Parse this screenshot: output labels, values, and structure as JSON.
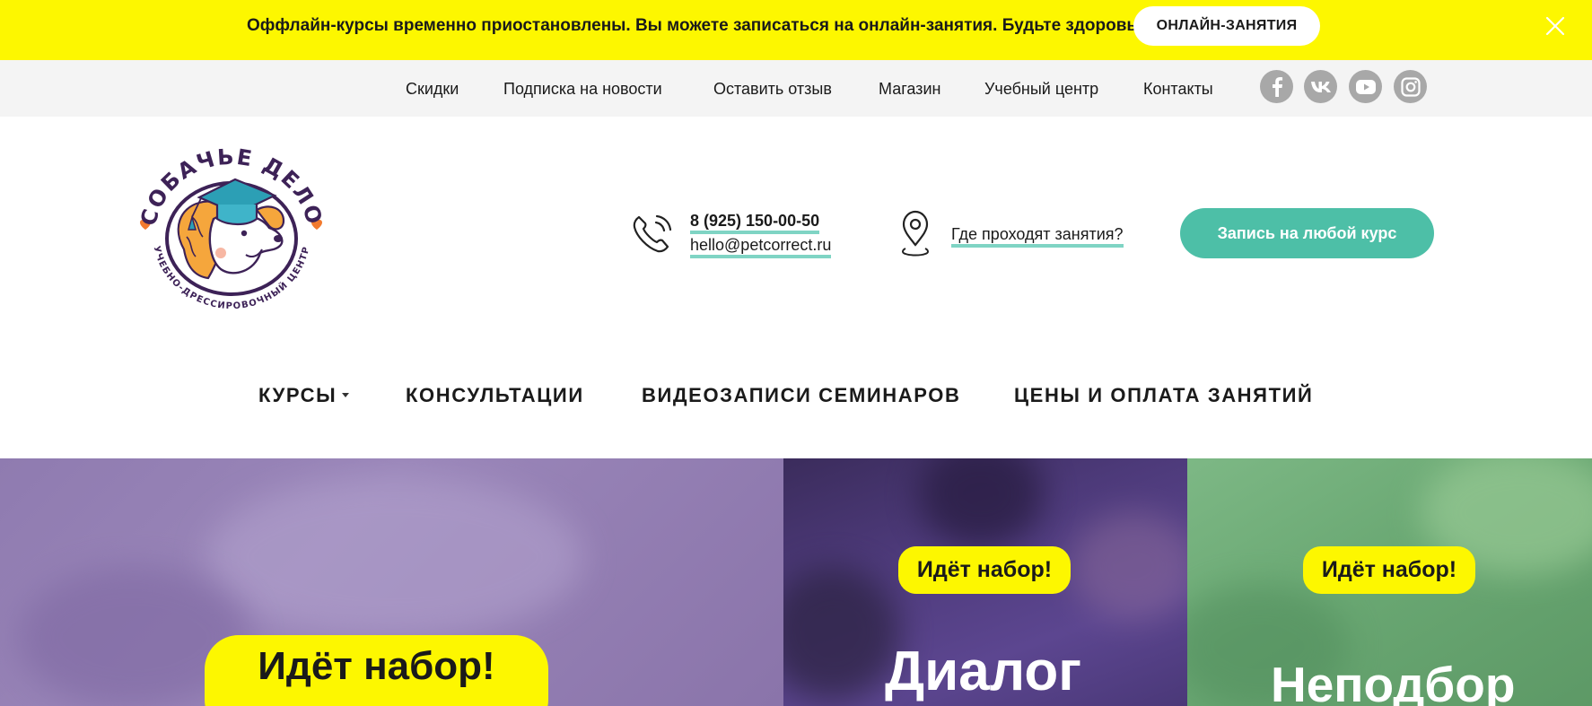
{
  "banner": {
    "text": "Оффлайн-курсы временно приостановлены. Вы можете записаться на онлайн-занятия. Будьте здоровы!",
    "button_label": "ОНЛАЙН-ЗАНЯТИЯ",
    "close_icon": "close-icon"
  },
  "subnav": {
    "items": [
      {
        "label": "Скидки"
      },
      {
        "label": "Подписка на новости"
      },
      {
        "label": "Оставить отзыв"
      },
      {
        "label": "Магазин"
      },
      {
        "label": "Учебный центр"
      },
      {
        "label": "Контакты"
      }
    ],
    "social": [
      "facebook-icon",
      "vk-icon",
      "youtube-icon",
      "instagram-icon"
    ]
  },
  "header": {
    "logo": {
      "title": "СОБАЧЬЕ ДЕЛО",
      "subtitle": "УЧЕБНО-ДРЕССИРОВОЧНЫЙ ЦЕНТР"
    },
    "phone": "8 (925) 150-00-50",
    "email": "hello@petcorrect.ru",
    "where_label": "Где проходят занятия?",
    "cta_label": "Запись на любой курс"
  },
  "mainnav": {
    "items": [
      {
        "label": "КУРСЫ"
      },
      {
        "label": "КОНСУЛЬТАЦИИ"
      },
      {
        "label": "ВИДЕОЗАПИСИ СЕМИНАРОВ"
      },
      {
        "label": "ЦЕНЫ И ОПЛАТА ЗАНЯТИЙ"
      }
    ]
  },
  "hero": {
    "panels": [
      {
        "badge": "Идёт набор!",
        "title": ""
      },
      {
        "badge": "Идёт набор!",
        "title": "Диалог"
      },
      {
        "badge": "Идёт набор!",
        "title": "Неподбор"
      }
    ]
  },
  "colors": {
    "banner_bg": "#fdf700",
    "accent_teal": "#4dbfa7",
    "underline_teal": "#7fd4c4",
    "logo_purple": "#3d2257"
  }
}
